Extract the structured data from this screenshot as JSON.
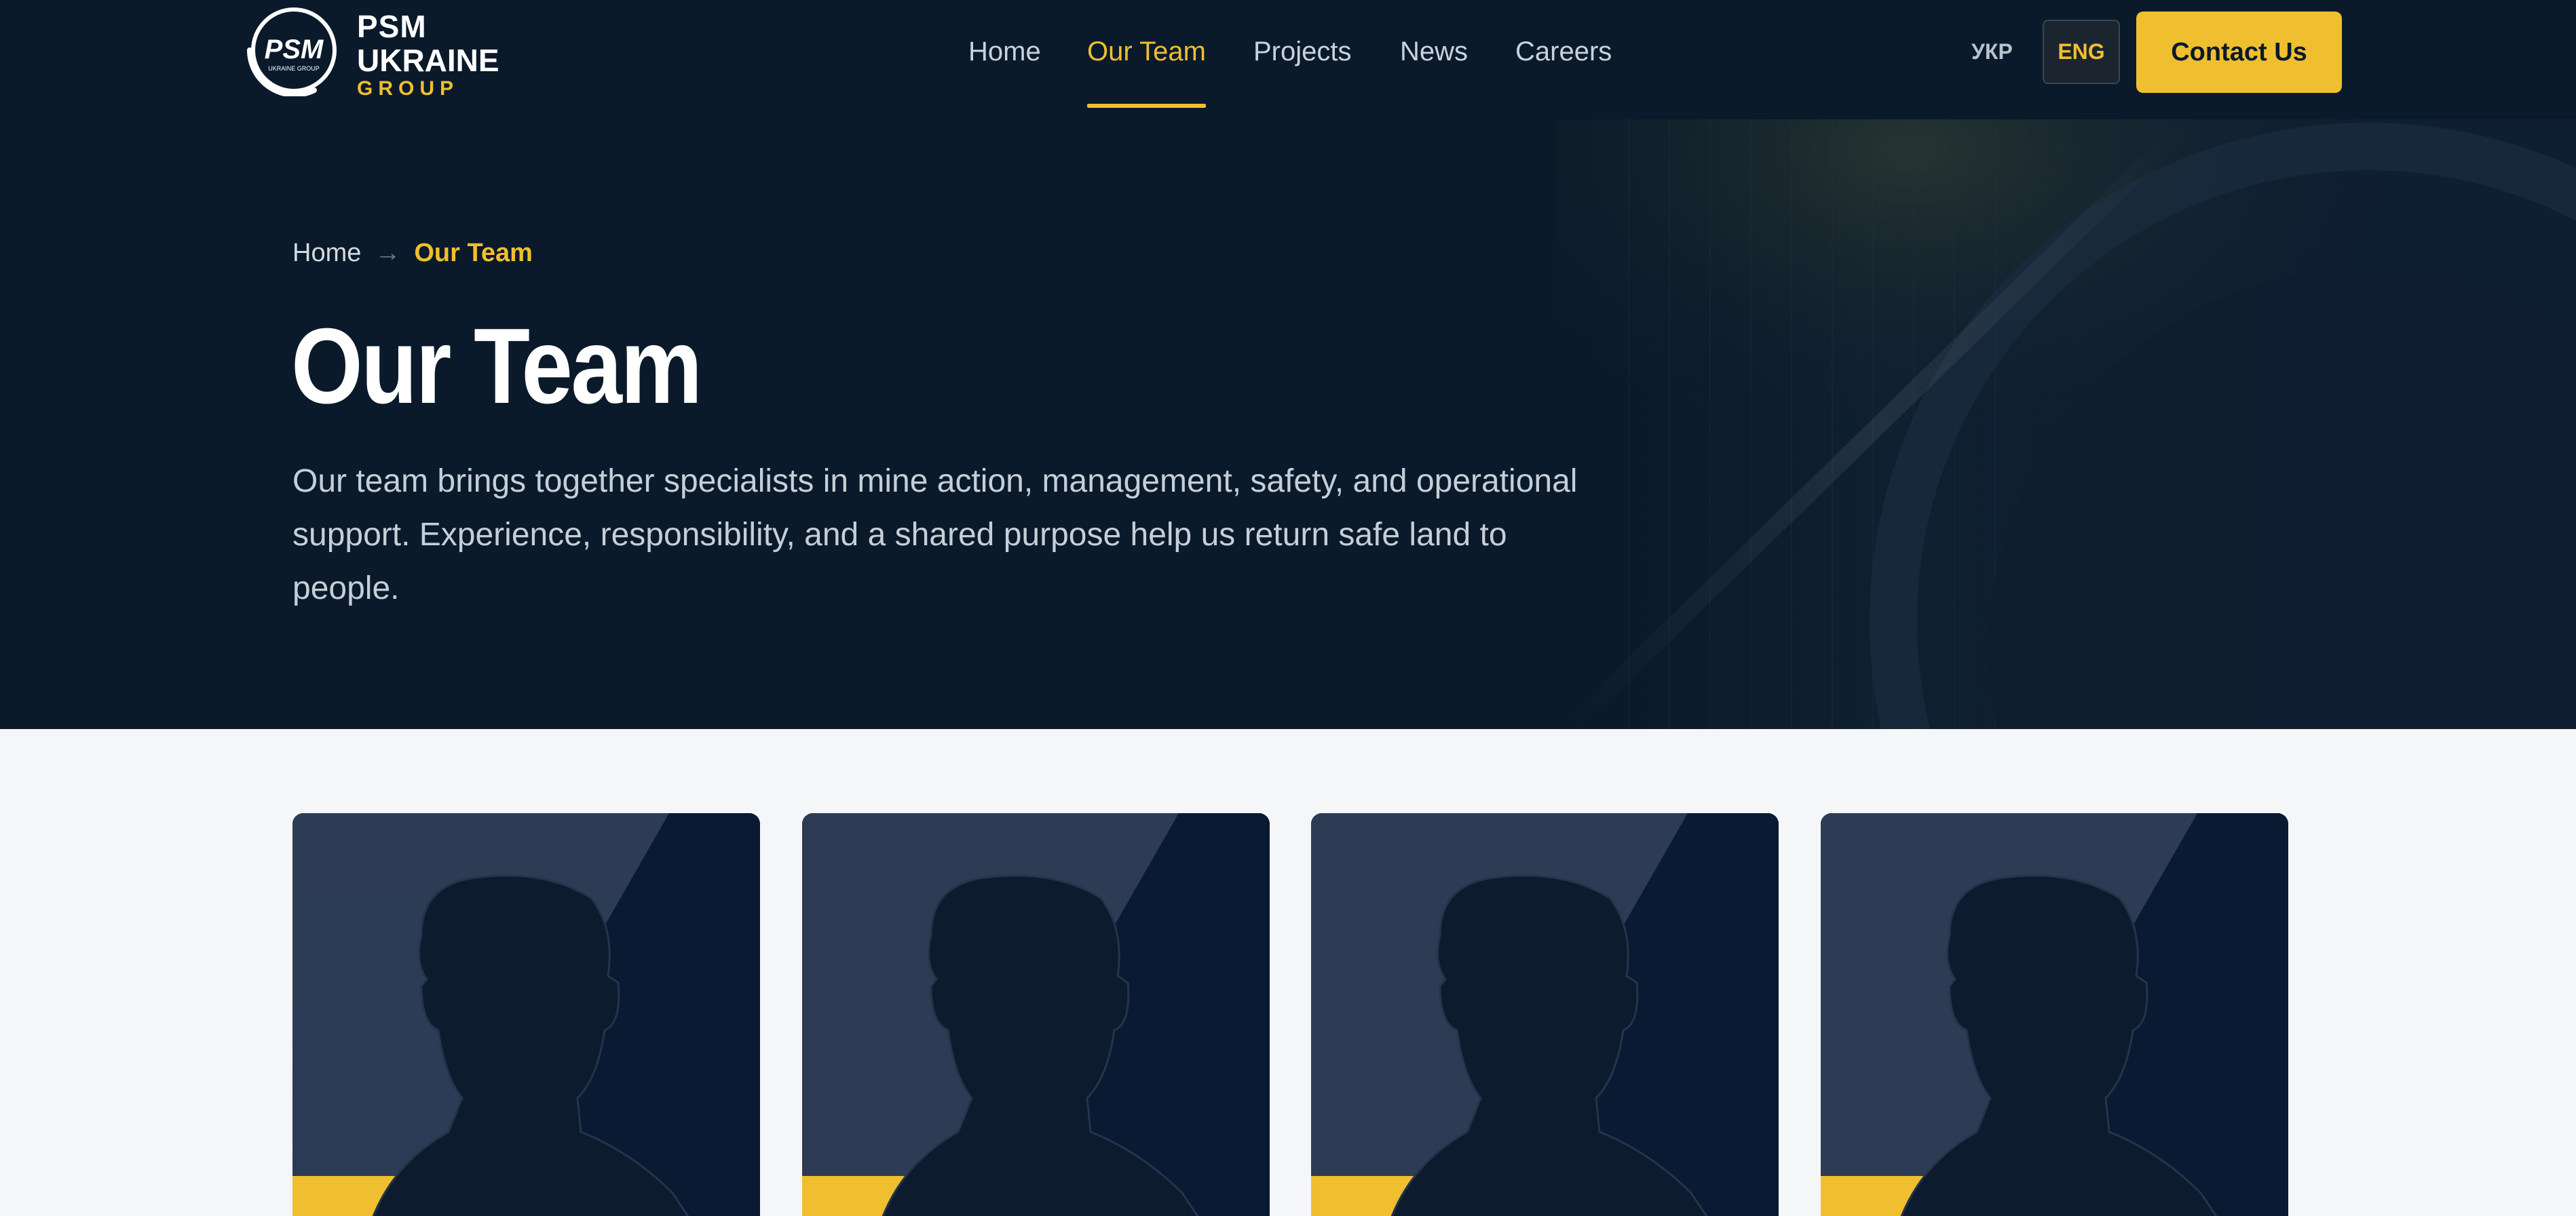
{
  "brand": {
    "logo_mark": "PSM",
    "logo_mark_sub": "UKRAINE GROUP",
    "line1": "PSM",
    "line2": "UKRAINE",
    "line3": "GROUP"
  },
  "nav": {
    "items": [
      {
        "label": "Home",
        "active": false
      },
      {
        "label": "Our Team",
        "active": true
      },
      {
        "label": "Projects",
        "active": false
      },
      {
        "label": "News",
        "active": false
      },
      {
        "label": "Careers",
        "active": false
      }
    ]
  },
  "lang": {
    "ukr": "УКР",
    "eng": "ENG",
    "selected": "ENG"
  },
  "cta": {
    "label": "Contact Us"
  },
  "breadcrumb": {
    "home": "Home",
    "separator": "→",
    "current": "Our Team"
  },
  "hero": {
    "title": "Our Team",
    "description": "Our team brings together specialists in mine action, management, safety, and operational support. Experience, responsibility, and a shared purpose help us return safe land to people."
  },
  "team": {
    "members": [
      {
        "photo": "person-silhouette-icon"
      },
      {
        "photo": "person-silhouette-icon"
      },
      {
        "photo": "person-silhouette-icon"
      },
      {
        "photo": "person-silhouette-icon"
      }
    ]
  },
  "colors": {
    "navy": "#0b1a2a",
    "accent": "#f0bf2f",
    "page_bg": "#f4f6f8"
  }
}
